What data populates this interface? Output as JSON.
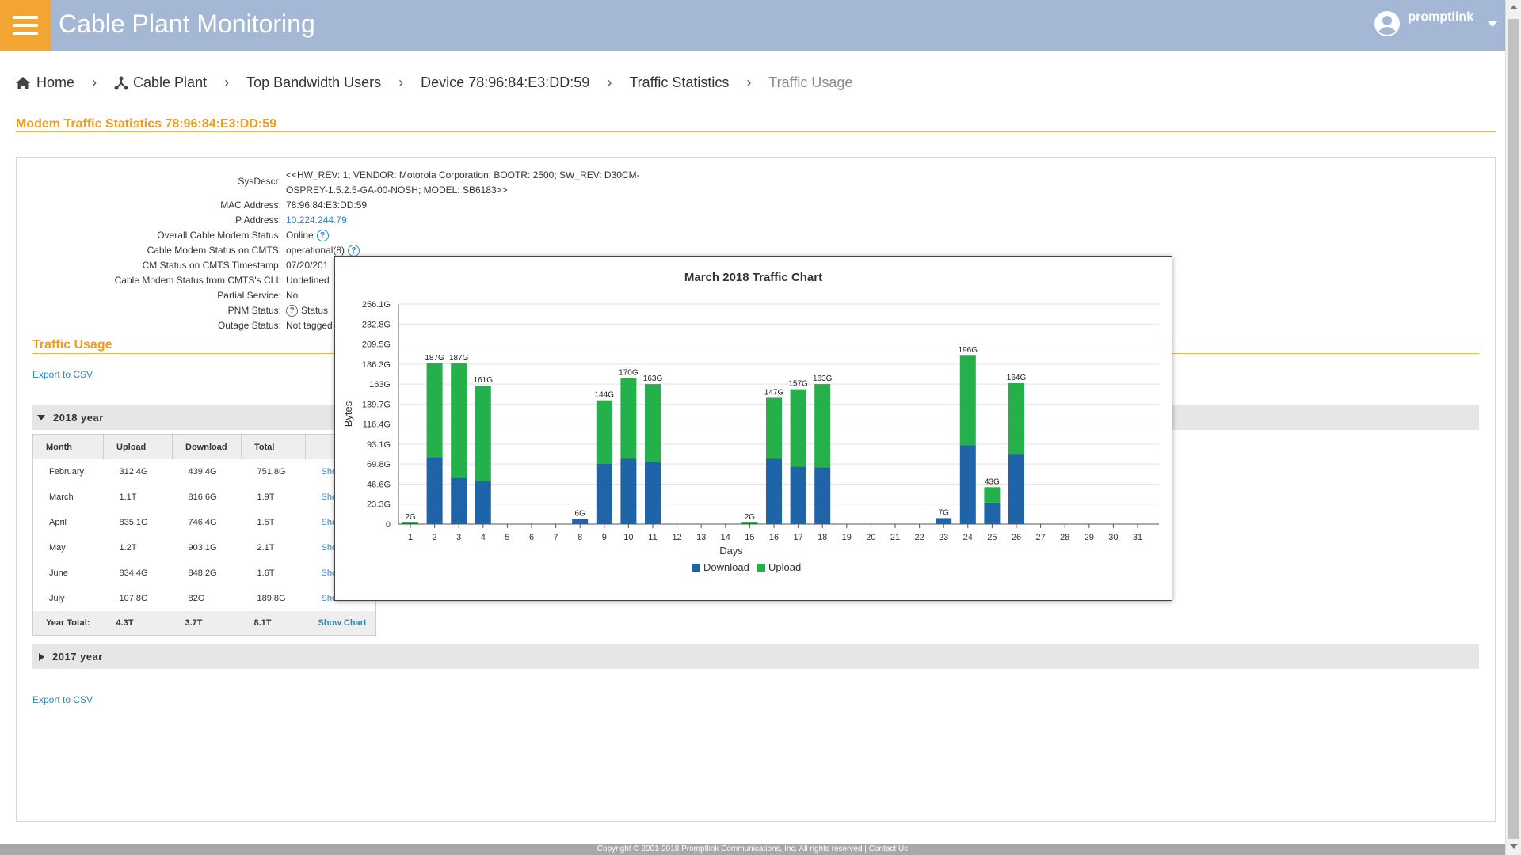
{
  "header": {
    "title": "Cable Plant Monitoring",
    "menu_icon": "hamburger-icon",
    "user_name": "promptlink",
    "user_icon": "user-circle-icon"
  },
  "breadcrumb": [
    {
      "label": "Home",
      "icon": "home-icon"
    },
    {
      "label": "Cable Plant",
      "icon": "network-icon"
    },
    {
      "label": "Top Bandwidth Users"
    },
    {
      "label": "Device 78:96:84:E3:DD:59"
    },
    {
      "label": "Traffic Statistics"
    },
    {
      "label": "Traffic Usage"
    }
  ],
  "page_title": "Modem Traffic Statistics 78:96:84:E3:DD:59",
  "info": {
    "sysdescr_label": "SysDescr:",
    "sysdescr_line1": "<<HW_REV: 1; VENDOR: Motorola Corporation; BOOTR: 2500; SW_REV: D30CM-",
    "sysdescr_line2": "OSPREY-1.5.2.5-GA-00-NOSH; MODEL: SB6183>>",
    "mac_label": "MAC Address:",
    "mac_value": "78:96:84:E3:DD:59",
    "ip_label": "IP Address:",
    "ip_value": "10.224.244.79",
    "overall_label": "Overall Cable Modem Status:",
    "overall_value": "Online",
    "cmts_label": "Cable Modem Status on CMTS:",
    "cmts_value": "operational(8)",
    "timestamp_label": "CM Status on CMTS Timestamp:",
    "timestamp_value": "07/20/201",
    "cli_label": "Cable Modem Status from CMTS's CLI:",
    "cli_value": "Undefined",
    "partial_label": "Partial Service:",
    "partial_value": "No",
    "pnm_label": "PNM Status:",
    "pnm_value": "Status",
    "outage_label": "Outage Status:",
    "outage_value": "Not tagged"
  },
  "traffic": {
    "section_title": "Traffic Usage",
    "export_label": "Export to CSV",
    "year_2018": "2018 year",
    "year_2017": "2017 year",
    "columns": [
      "Month",
      "Upload",
      "Download",
      "Total",
      ""
    ],
    "rows": [
      {
        "month": "February",
        "upload": "312.4G",
        "download": "439.4G",
        "total": "751.8G",
        "action": "Show"
      },
      {
        "month": "March",
        "upload": "1.1T",
        "download": "816.6G",
        "total": "1.9T",
        "action": "Show"
      },
      {
        "month": "April",
        "upload": "835.1G",
        "download": "746.4G",
        "total": "1.5T",
        "action": "Show"
      },
      {
        "month": "May",
        "upload": "1.2T",
        "download": "903.1G",
        "total": "2.1T",
        "action": "Show"
      },
      {
        "month": "June",
        "upload": "834.4G",
        "download": "848.2G",
        "total": "1.6T",
        "action": "Show"
      },
      {
        "month": "July",
        "upload": "107.8G",
        "download": "82G",
        "total": "189.8G",
        "action": "Show Chart"
      }
    ],
    "year_total": {
      "label": "Year Total:",
      "upload": "4.3T",
      "download": "3.7T",
      "total": "8.1T",
      "action": "Show Chart"
    }
  },
  "colors": {
    "download": "#1f64a8",
    "upload": "#24b04a",
    "accent": "#f09c1e",
    "header": "#a4b7d4",
    "link": "#2a87c8"
  },
  "chart_data": {
    "type": "bar",
    "stacked": true,
    "title": "March 2018 Traffic Chart",
    "xlabel": "Days",
    "ylabel": "Bytes",
    "ylim": [
      0,
      256.1
    ],
    "yticks": [
      "0",
      "23.3G",
      "46.6G",
      "69.8G",
      "93.1G",
      "116.4G",
      "139.7G",
      "163G",
      "186.3G",
      "209.5G",
      "232.8G",
      "256.1G"
    ],
    "categories": [
      "1",
      "2",
      "3",
      "4",
      "5",
      "6",
      "7",
      "8",
      "9",
      "10",
      "11",
      "12",
      "13",
      "14",
      "15",
      "16",
      "17",
      "18",
      "19",
      "20",
      "21",
      "22",
      "23",
      "24",
      "25",
      "26",
      "27",
      "28",
      "29",
      "30",
      "31"
    ],
    "series": [
      {
        "name": "Download",
        "values": [
          1,
          78,
          54,
          50,
          0,
          0,
          0,
          6,
          70,
          76,
          72,
          0,
          0,
          0,
          1,
          76,
          67,
          66,
          0,
          0,
          0,
          0,
          7,
          92,
          25,
          81,
          0,
          0,
          0,
          0,
          0
        ]
      },
      {
        "name": "Upload",
        "values": [
          1,
          109,
          133,
          111,
          0,
          0,
          0,
          0,
          74,
          94,
          91,
          0,
          0,
          0,
          1,
          71,
          90,
          97,
          0,
          0,
          0,
          0,
          0,
          104,
          18,
          83,
          0,
          0,
          0,
          0,
          0
        ]
      }
    ],
    "totals": [
      "2G",
      "187G",
      "187G",
      "161G",
      "",
      "",
      "",
      "6G",
      "144G",
      "170G",
      "163G",
      "",
      "",
      "",
      "2G",
      "147G",
      "157G",
      "163G",
      "",
      "",
      "",
      "",
      "7G",
      "196G",
      "43G",
      "164G",
      "",
      "",
      "",
      "",
      ""
    ],
    "legend": "bottom-center",
    "grid": true
  },
  "footer": {
    "copyright": "Copyright © 2001-2018 Promptlink Communications, Inc. All rights reserved",
    "contact": "Contact Us",
    "separator": "|"
  }
}
